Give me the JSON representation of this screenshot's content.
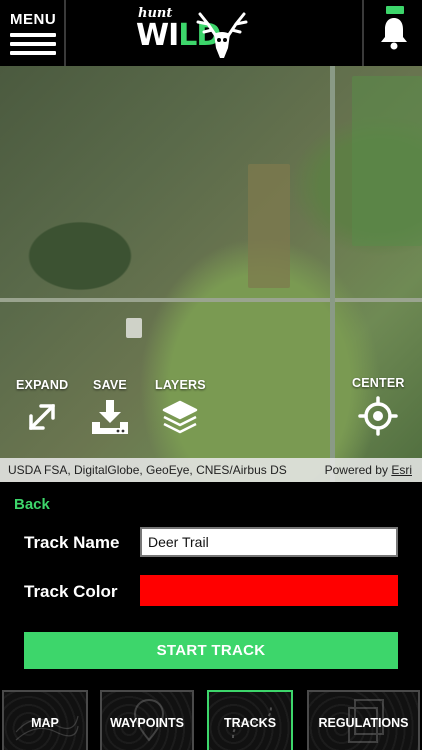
{
  "header": {
    "menu_label": "MENU",
    "logo_hunt": "hunt",
    "logo_wild_w": "WI",
    "logo_wild_ld": "LD",
    "accent_color": "#3dd66b"
  },
  "map": {
    "controls": {
      "expand": "EXPAND",
      "save": "SAVE",
      "layers": "LAYERS",
      "center": "CENTER"
    },
    "attribution": "USDA FSA, DigitalGlobe, GeoEye, CNES/Airbus DS",
    "powered_by": "Powered by",
    "powered_by_link": "Esri"
  },
  "panel": {
    "back_label": "Back",
    "track_name_label": "Track Name",
    "track_name_value": "Deer Trail",
    "track_color_label": "Track Color",
    "track_color_value": "#ff0000",
    "start_button": "START TRACK"
  },
  "tabs": [
    {
      "label": "MAP",
      "active": false
    },
    {
      "label": "WAYPOINTS",
      "active": false
    },
    {
      "label": "TRACKS",
      "active": true
    },
    {
      "label": "REGULATIONS",
      "active": false
    }
  ]
}
